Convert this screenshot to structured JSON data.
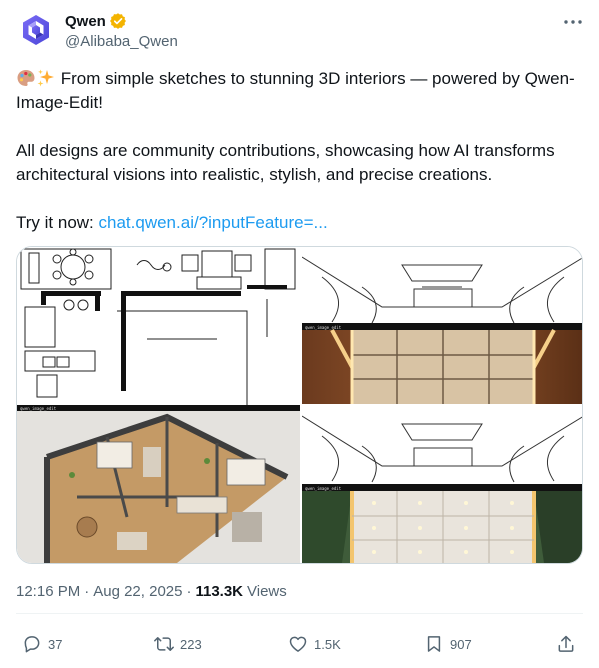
{
  "author": {
    "name": "Qwen",
    "handle": "@Alibaba_Qwen",
    "verified_color": "#f4b400"
  },
  "tweet": {
    "line1": "From simple sketches to stunning 3D interiors — powered by Qwen-Image-Edit!",
    "line2": "All designs are community contributions, showcasing how AI transforms architectural visions into realistic, stylish, and precise creations.",
    "try_prefix": "Try it now:",
    "link_text": "chat.qwen.ai/?inputFeature=...",
    "emojis": [
      "artist-palette",
      "sparkles"
    ]
  },
  "media": {
    "watermark": "qwen_image_edit"
  },
  "meta": {
    "time": "12:16 PM",
    "separator1": "·",
    "date": "Aug 22, 2025",
    "separator2": "·",
    "views_count": "113.3K",
    "views_label": "Views"
  },
  "actions": {
    "replies": "37",
    "reposts": "223",
    "likes": "1.5K",
    "bookmarks": "907"
  },
  "colors": {
    "link": "#1d9bf0",
    "muted": "#536471",
    "text": "#0f1419",
    "brand_purple": "#615ced"
  }
}
